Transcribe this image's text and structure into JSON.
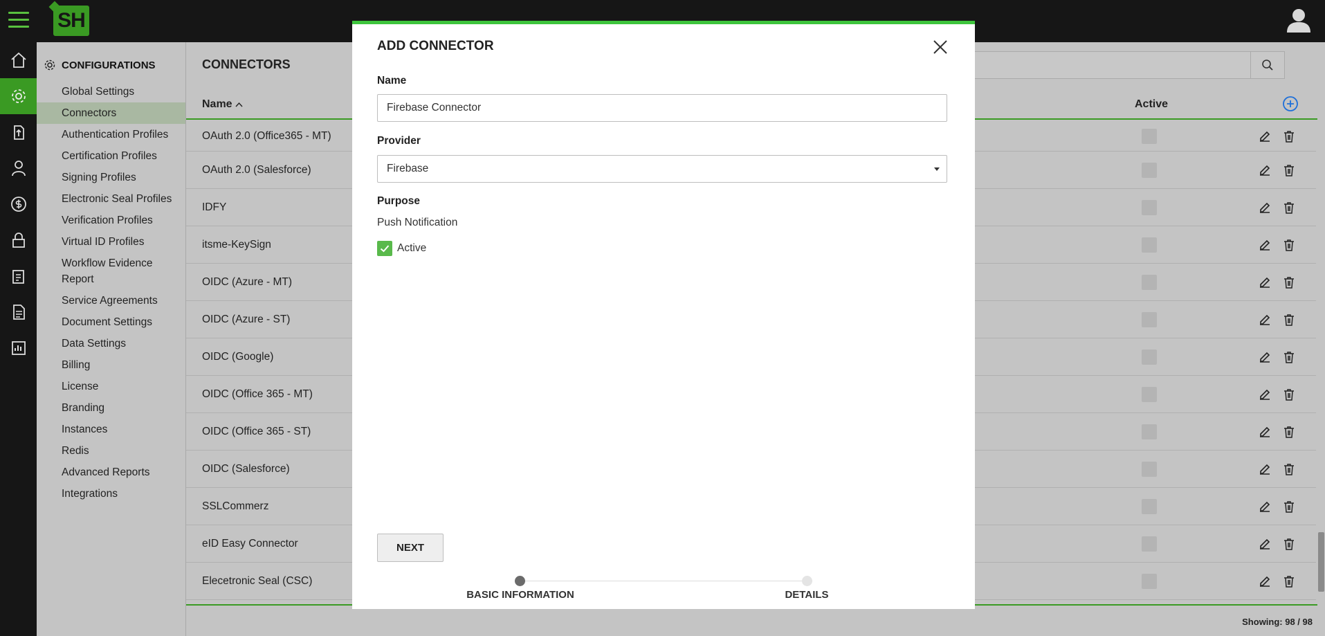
{
  "topbar": {
    "logo_text": "SH"
  },
  "sidebar": {
    "title": "CONFIGURATIONS",
    "items": [
      {
        "label": "Global Settings"
      },
      {
        "label": "Connectors"
      },
      {
        "label": "Authentication Profiles"
      },
      {
        "label": "Certification Profiles"
      },
      {
        "label": "Signing Profiles"
      },
      {
        "label": "Electronic Seal Profiles"
      },
      {
        "label": "Verification Profiles"
      },
      {
        "label": "Virtual ID Profiles"
      },
      {
        "label": "Workflow Evidence Report"
      },
      {
        "label": "Service Agreements"
      },
      {
        "label": "Document Settings"
      },
      {
        "label": "Data Settings"
      },
      {
        "label": "Billing"
      },
      {
        "label": "License"
      },
      {
        "label": "Branding"
      },
      {
        "label": "Instances"
      },
      {
        "label": "Redis"
      },
      {
        "label": "Advanced Reports"
      },
      {
        "label": "Integrations"
      }
    ],
    "active_item": "Connectors"
  },
  "main": {
    "title": "CONNECTORS",
    "columns": {
      "name": "Name",
      "active": "Active"
    },
    "rows": [
      {
        "name": "OAuth 2.0 (Office365 - MT)",
        "active": false
      },
      {
        "name": "OAuth 2.0 (Salesforce)",
        "active": false
      },
      {
        "name": "IDFY",
        "active": false
      },
      {
        "name": "itsme-KeySign",
        "active": false
      },
      {
        "name": "OIDC (Azure - MT)",
        "active": false
      },
      {
        "name": "OIDC (Azure - ST)",
        "active": false
      },
      {
        "name": "OIDC (Google)",
        "active": false
      },
      {
        "name": "OIDC (Office 365 - MT)",
        "active": false
      },
      {
        "name": "OIDC (Office 365 - ST)",
        "active": false
      },
      {
        "name": "OIDC (Salesforce)",
        "active": false
      },
      {
        "name": "SSLCommerz",
        "active": false
      },
      {
        "name": "eID Easy Connector",
        "active": false
      },
      {
        "name": "Elecetronic Seal (CSC)",
        "active": false
      }
    ],
    "showing": "Showing: 98 / 98"
  },
  "modal": {
    "title": "ADD CONNECTOR",
    "name_label": "Name",
    "name_value": "Firebase Connector",
    "provider_label": "Provider",
    "provider_value": "Firebase",
    "purpose_label": "Purpose",
    "purpose_value": "Push Notification",
    "active_label": "Active",
    "active_checked": true,
    "next_label": "NEXT",
    "steps": [
      {
        "label": "BASIC INFORMATION",
        "current": true
      },
      {
        "label": "DETAILS",
        "current": false
      }
    ]
  },
  "colors": {
    "accent": "#3a9a23",
    "modal_top_border": "#3ec53d",
    "checkbox_checked": "#59b94b",
    "add_icon": "#1e6fd9"
  },
  "icons": {
    "rail": [
      "home-icon",
      "gear-icon",
      "upload-icon",
      "user-icon",
      "dollar-icon",
      "lock-icon",
      "clipboard-icon",
      "document-icon",
      "report-icon"
    ]
  }
}
